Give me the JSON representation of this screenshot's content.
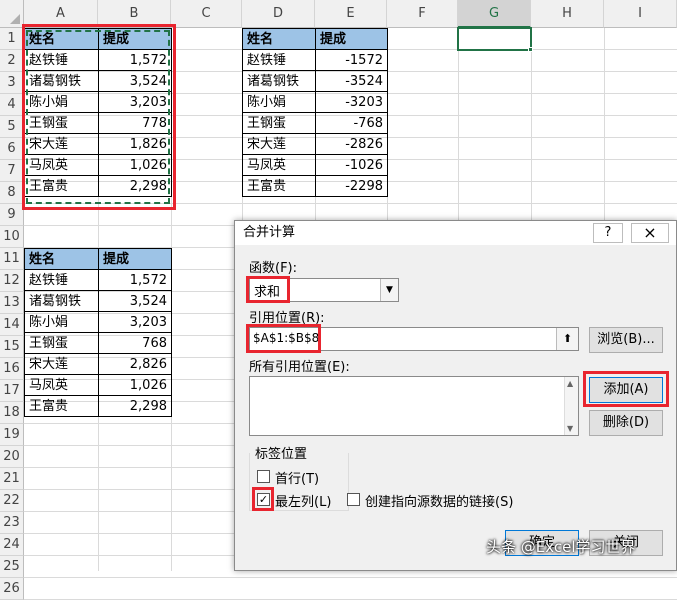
{
  "columns": [
    "A",
    "B",
    "C",
    "D",
    "E",
    "F",
    "G",
    "H",
    "I"
  ],
  "rows": [
    "1",
    "2",
    "3",
    "4",
    "5",
    "6",
    "7",
    "8",
    "9",
    "10",
    "11",
    "12",
    "13",
    "14",
    "15",
    "16",
    "17",
    "18",
    "19",
    "20",
    "21",
    "22",
    "23",
    "24",
    "25",
    "26"
  ],
  "table1": {
    "headers": [
      "姓名",
      "提成"
    ],
    "rows": [
      [
        "赵铁锤",
        "1,572"
      ],
      [
        "诸葛钢铁",
        "3,524"
      ],
      [
        "陈小娟",
        "3,203"
      ],
      [
        "王钢蛋",
        "778"
      ],
      [
        "宋大莲",
        "1,826"
      ],
      [
        "马凤英",
        "1,026"
      ],
      [
        "王富贵",
        "2,298"
      ]
    ]
  },
  "table2": {
    "headers": [
      "姓名",
      "提成"
    ],
    "rows": [
      [
        "赵铁锤",
        "-1572"
      ],
      [
        "诸葛钢铁",
        "-3524"
      ],
      [
        "陈小娟",
        "-3203"
      ],
      [
        "王钢蛋",
        "-768"
      ],
      [
        "宋大莲",
        "-2826"
      ],
      [
        "马凤英",
        "-1026"
      ],
      [
        "王富贵",
        "-2298"
      ]
    ]
  },
  "table3": {
    "headers": [
      "姓名",
      "提成"
    ],
    "rows": [
      [
        "赵铁锤",
        "1,572"
      ],
      [
        "诸葛钢铁",
        "3,524"
      ],
      [
        "陈小娟",
        "3,203"
      ],
      [
        "王钢蛋",
        "768"
      ],
      [
        "宋大莲",
        "2,826"
      ],
      [
        "马凤英",
        "1,026"
      ],
      [
        "王富贵",
        "2,298"
      ]
    ]
  },
  "dialog": {
    "title": "合并计算",
    "help": "?",
    "close": "×",
    "function_label": "函数(F):",
    "function_value": "求和",
    "ref_label": "引用位置(R):",
    "ref_value": "$A$1:$B$8",
    "browse": "浏览(B)...",
    "all_refs_label": "所有引用位置(E):",
    "add": "添加(A)",
    "delete": "删除(D)",
    "label_group": "标签位置",
    "top_row": "首行(T)",
    "left_col": "最左列(L)",
    "create_links": "创建指向源数据的链接(S)",
    "ok": "确定",
    "cancel": "关闭"
  },
  "watermark": "头条 @Excel学习世界",
  "colors": {
    "header_fill": "#9dc3e6",
    "highlight": "#e8252f",
    "selection": "#217346"
  }
}
